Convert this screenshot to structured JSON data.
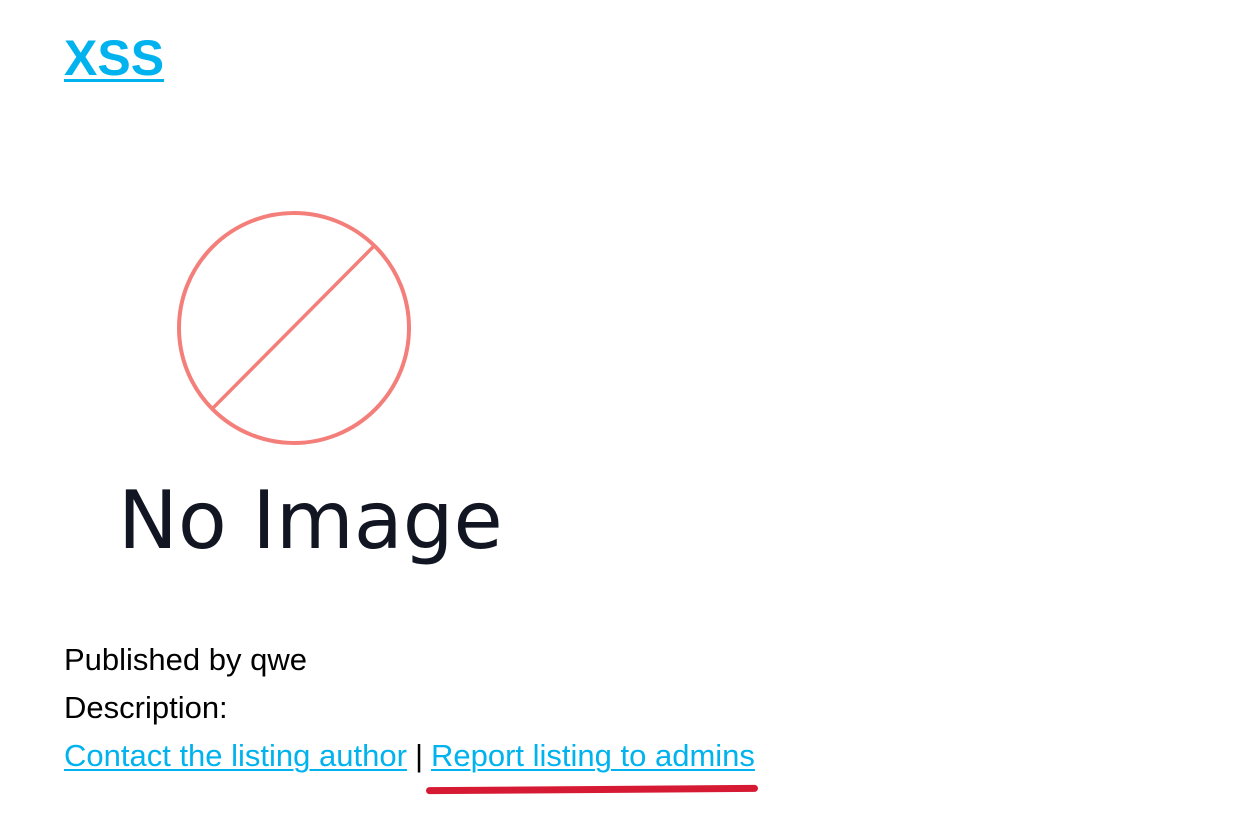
{
  "header": {
    "title": "XSS"
  },
  "listing": {
    "image_alt_text": "No Image",
    "published_by": "Published by qwe",
    "description_label": "Description:",
    "separator": "|"
  },
  "actions": {
    "contact_link": "Contact the listing author",
    "report_link": "Report listing to admins"
  },
  "colors": {
    "link": "#00b3ee",
    "placeholder_circle": "#f47f7a",
    "annotation": "#d71a33"
  },
  "icons": {
    "placeholder": "no-image-prohibited-circle-icon"
  }
}
